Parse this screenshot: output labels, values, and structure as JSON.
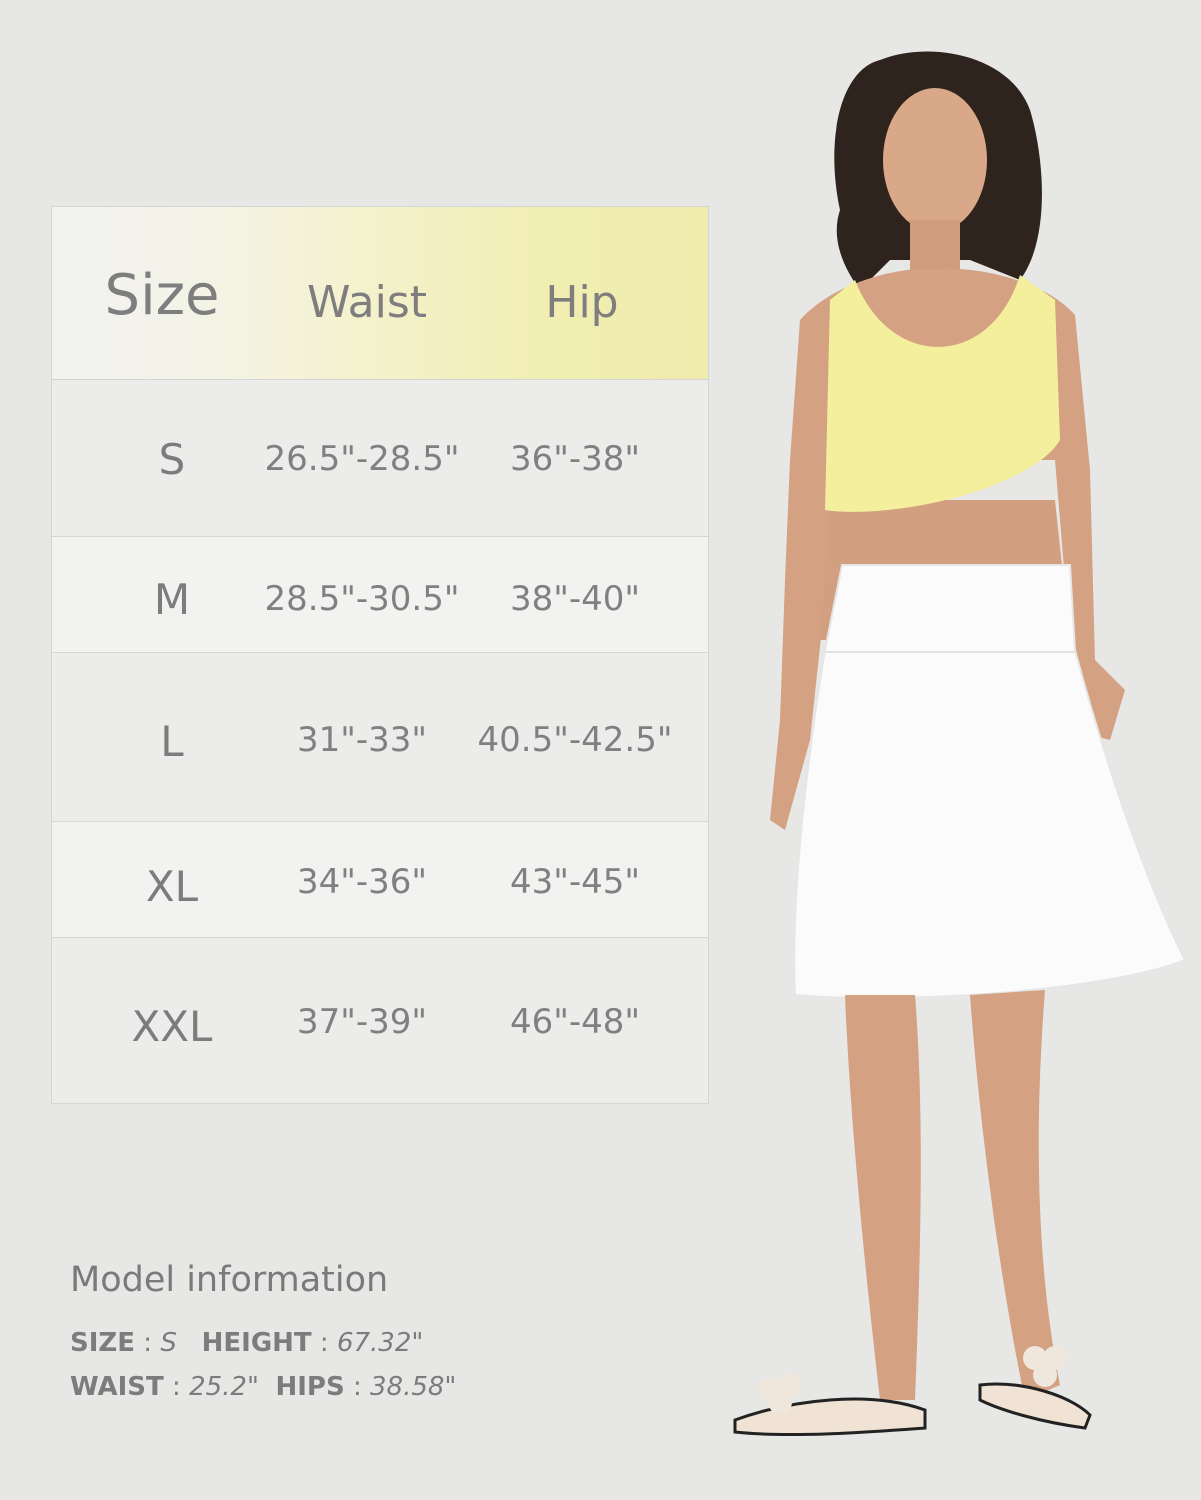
{
  "size_chart": {
    "headers": [
      "Size",
      "Waist",
      "Hip"
    ],
    "rows": [
      {
        "size": "S",
        "waist": "26.5\"-28.5\"",
        "hip": "36\"-38\""
      },
      {
        "size": "M",
        "waist": "28.5\"-30.5\"",
        "hip": "38\"-40\""
      },
      {
        "size": "L",
        "waist": "31\"-33\"",
        "hip": "40.5\"-42.5\""
      },
      {
        "size": "XL",
        "waist": "34\"-36\"",
        "hip": "43\"-45\""
      },
      {
        "size": "XXL",
        "waist": "37\"-39\"",
        "hip": "46\"-48\""
      }
    ]
  },
  "model_info": {
    "title": "Model information",
    "size_label": "SIZE",
    "size_value": "S",
    "height_label": "HEIGHT",
    "height_value": "67.32\"",
    "waist_label": "WAIST",
    "waist_value": "25.2\"",
    "hips_label": "HIPS",
    "hips_value": "38.58\""
  },
  "colors": {
    "background": "#e7e7e6",
    "header_accent": "#f0ecac",
    "text": "#808080",
    "top": "#f3ef9c",
    "skirt": "#ffffff"
  }
}
